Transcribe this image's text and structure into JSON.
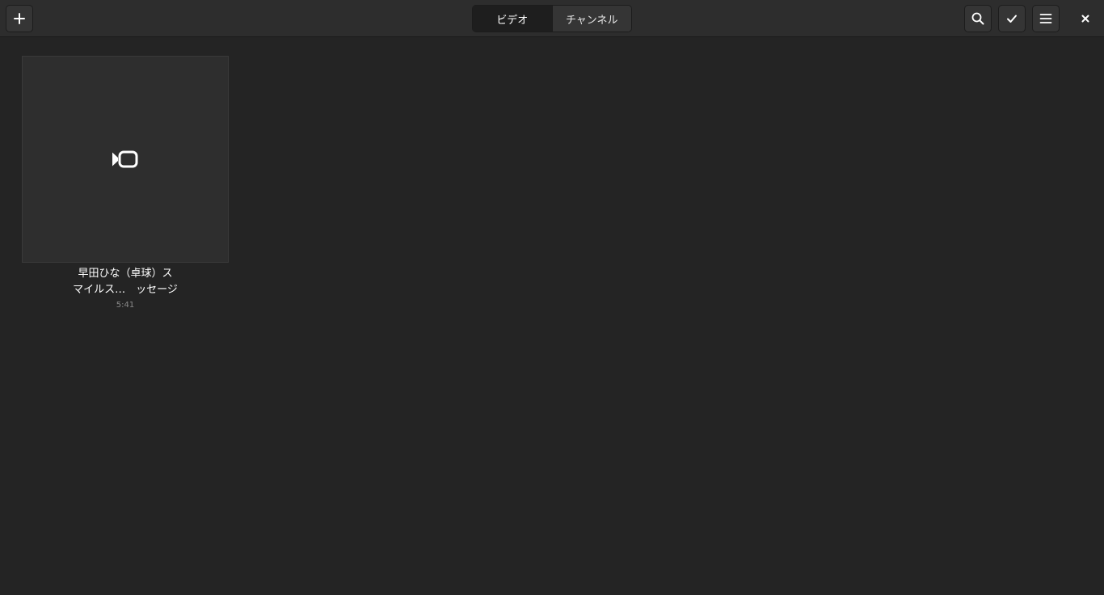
{
  "header": {
    "tabs": [
      {
        "label": "ビデオ",
        "active": true
      },
      {
        "label": "チャンネル",
        "active": false
      }
    ],
    "icons": {
      "add": "plus-icon",
      "search": "search-icon",
      "select": "checkmark-icon",
      "menu": "hamburger-menu-icon",
      "close": "close-icon"
    }
  },
  "videos": [
    {
      "title_line1": "早田ひな（卓球）ス",
      "title_line2": "マイルス…　ッセージ",
      "duration": "5:41",
      "thumbnail_icon": "video-camera-icon"
    }
  ],
  "colors": {
    "background": "#242424",
    "headerbar": "#2d2d2d",
    "thumbnail": "#2e2e2e",
    "text": "#ffffff",
    "muted_text": "#8a8a8a"
  }
}
